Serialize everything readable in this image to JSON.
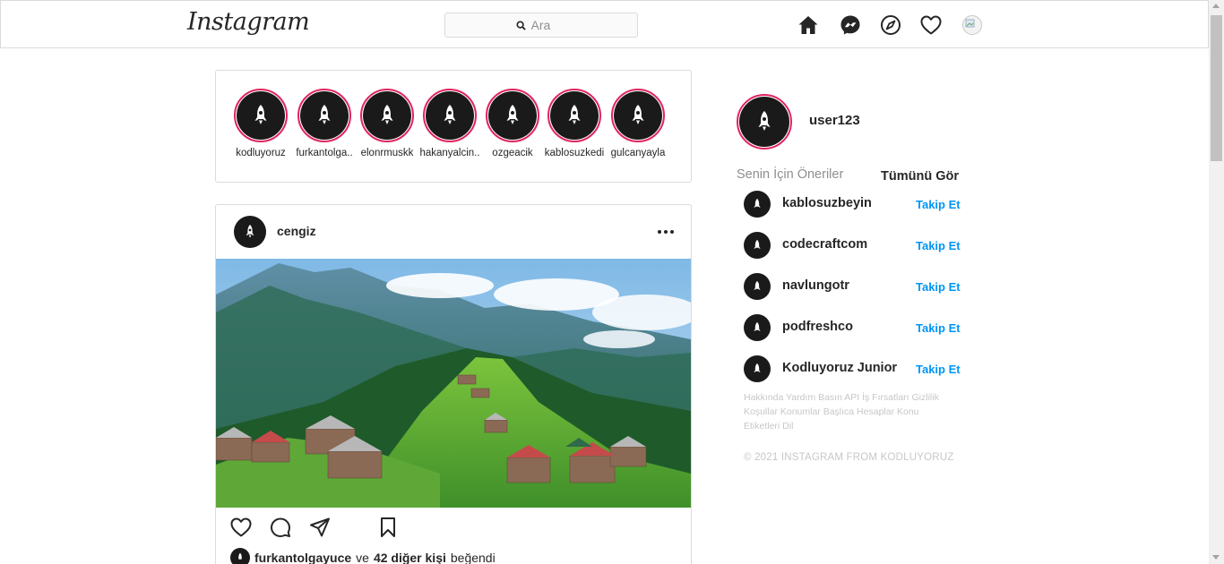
{
  "nav": {
    "logo": "Instagram",
    "search_placeholder": "Ara",
    "icons": [
      "home-icon",
      "messenger-icon",
      "explore-icon",
      "heart-icon",
      "profile-avatar"
    ]
  },
  "stories": [
    {
      "name": "kodluyoruz"
    },
    {
      "name": "furkantolga.."
    },
    {
      "name": "elonrmuskk"
    },
    {
      "name": "hakanyalcin.."
    },
    {
      "name": "ozgeacik"
    },
    {
      "name": "kablosuzkedi"
    },
    {
      "name": "gulcanyayla"
    }
  ],
  "post": {
    "username": "cengiz",
    "liked_by": "furkantolgayuce",
    "liked_connector": "ve",
    "others_count": "42 diğer kişi",
    "liked_suffix": "beğendi"
  },
  "sidebar": {
    "username": "user123",
    "suggestions_title": "Senin İçin Öneriler",
    "see_all": "Tümünü Gör",
    "suggestions": [
      {
        "name": "kablosuzbeyin",
        "action": "Takip Et"
      },
      {
        "name": "codecraftcom",
        "action": "Takip Et"
      },
      {
        "name": "navlungotr",
        "action": "Takip Et"
      },
      {
        "name": "podfreshco",
        "action": "Takip Et"
      },
      {
        "name": "Kodluyoruz Junior",
        "action": "Takip Et"
      }
    ],
    "footer_links": "Hakkında Yardım Basın API İş Fırsatları Gizlilik Koşullar Konumlar Başlıca Hesaplar Konu Etiketleri Dil",
    "copyright": "© 2021 INSTAGRAM FROM KODLUYORUZ"
  },
  "colors": {
    "story_ring": "#e0245e",
    "follow_link": "#0095f6",
    "border": "#dbdbdb"
  }
}
